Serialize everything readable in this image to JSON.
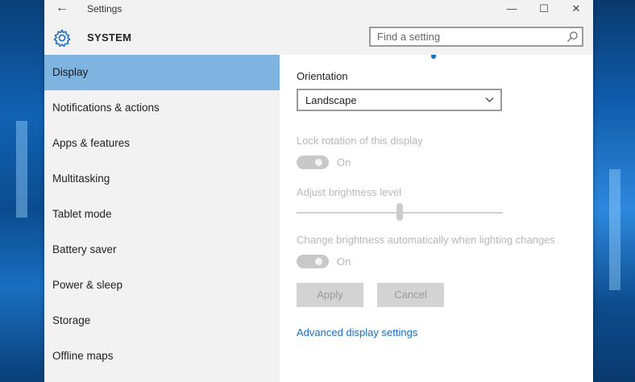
{
  "window": {
    "app_title": "Settings",
    "back_glyph": "←",
    "minimize_glyph": "—",
    "maximize_glyph": "☐",
    "close_glyph": "✕"
  },
  "header": {
    "section_title": "SYSTEM",
    "search_placeholder": "Find a setting"
  },
  "sidebar": {
    "items": [
      {
        "label": "Display",
        "active": true
      },
      {
        "label": "Notifications & actions",
        "active": false
      },
      {
        "label": "Apps & features",
        "active": false
      },
      {
        "label": "Multitasking",
        "active": false
      },
      {
        "label": "Tablet mode",
        "active": false
      },
      {
        "label": "Battery saver",
        "active": false
      },
      {
        "label": "Power & sleep",
        "active": false
      },
      {
        "label": "Storage",
        "active": false
      },
      {
        "label": "Offline maps",
        "active": false
      }
    ]
  },
  "display": {
    "orientation_label": "Orientation",
    "orientation_value": "Landscape",
    "lock_rotation_label": "Lock rotation of this display",
    "lock_rotation_state": "On",
    "brightness_label": "Adjust brightness level",
    "brightness_level": 0.5,
    "auto_brightness_label": "Change brightness automatically when lighting changes",
    "auto_brightness_state": "On",
    "apply_label": "Apply",
    "cancel_label": "Cancel",
    "advanced_link": "Advanced display settings"
  },
  "colors": {
    "accent": "#1a6fc2",
    "active_nav": "#7fb3e0"
  }
}
